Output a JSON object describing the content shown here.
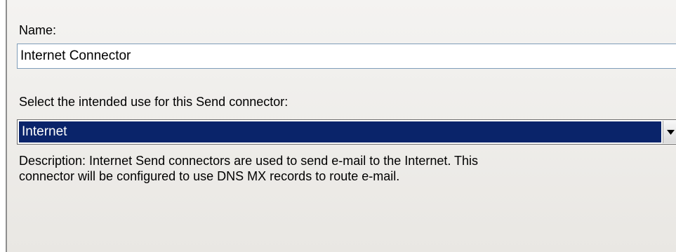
{
  "form": {
    "name_label": "Name:",
    "name_value": "Internet Connector",
    "intended_use_label": "Select the intended use for this Send connector:",
    "intended_use_selected": "Internet",
    "description_line1": "Description: Internet Send connectors are used to send e-mail to the Internet. This",
    "description_line2": "connector will be configured to use DNS MX records to route e-mail."
  },
  "icons": {
    "dropdown": "chevron-down-icon"
  },
  "colors": {
    "selection_bg": "#0a246a",
    "selection_text": "#ffffff",
    "panel_bg": "#f0efed"
  }
}
